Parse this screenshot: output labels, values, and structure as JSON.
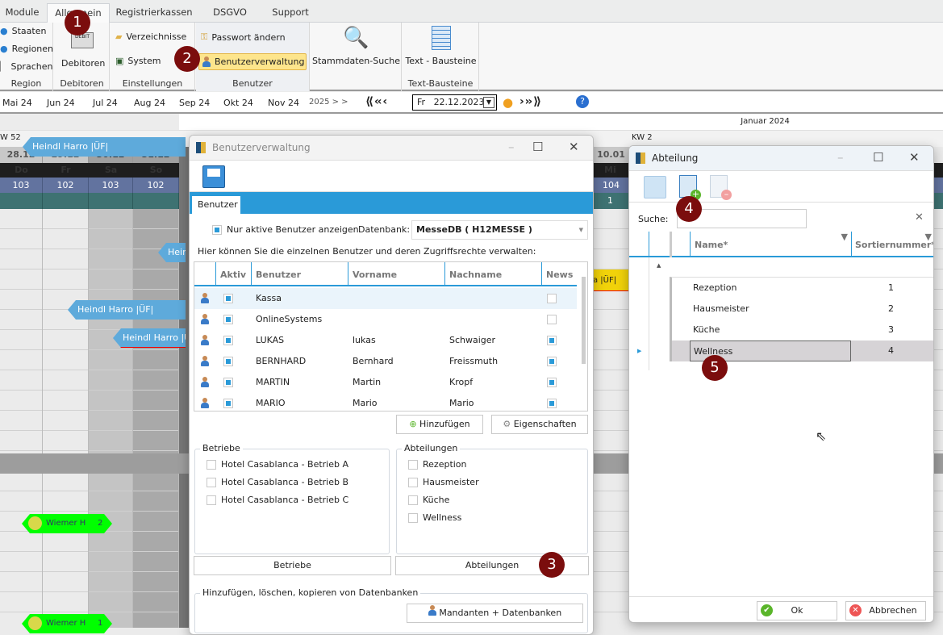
{
  "ribbon": {
    "tabs": [
      "Module",
      "Allgemein",
      "Registrierkassen",
      "DSGVO",
      "Support"
    ],
    "active_tab": "Allgemein",
    "region": {
      "items": [
        "Staaten",
        "Regionen",
        "Sprachen"
      ],
      "label": "Region"
    },
    "debitoren": {
      "button": "Debitoren",
      "label": "Debitoren",
      "icon_text": "DEBIT"
    },
    "einstellungen": {
      "items": [
        "Verzeichnisse",
        "System"
      ],
      "label": "Einstellungen"
    },
    "benutzer": {
      "items": [
        "Passwort ändern",
        "Benutzerverwaltung"
      ],
      "label": "Benutzer"
    },
    "stammdaten": {
      "button": "Stammdaten-Suche"
    },
    "textbausteine": {
      "button": "Text - Bausteine",
      "label": "Text-Bausteine"
    }
  },
  "nav": {
    "months": [
      "Mai 24",
      "Jun 24",
      "Jul 24",
      "Aug 24",
      "Sep 24",
      "Okt 24",
      "Nov 24"
    ],
    "next_year": "2025 > >",
    "date_day": "Fr",
    "date_value": "22.12.2023"
  },
  "calendar": {
    "month": "Januar 2024",
    "weeks": [
      "W 52",
      "KW 2"
    ],
    "dates": [
      {
        "d": "28.12",
        "w": "Do",
        "n": "103"
      },
      {
        "d": "29.12",
        "w": "Fr",
        "n": "102"
      },
      {
        "d": "30.12",
        "w": "Sa",
        "n": "103"
      },
      {
        "d": "31.12",
        "w": "So",
        "n": "102"
      }
    ],
    "right_col": {
      "d": "10.01",
      "w": "Mi",
      "n": "104",
      "c": "1"
    },
    "bookings": [
      "Heindl Harro |ÜF|",
      "Heindl Harro |ÜF|",
      "Heind",
      "Heindl Harro |ÜF|"
    ],
    "yellow_booking": "a |ÜF|",
    "green": [
      {
        "name": "Wiemer H",
        "n": "2"
      },
      {
        "name": "Wiemer H",
        "n": "1"
      }
    ]
  },
  "benutzerverwaltung": {
    "title": "Benutzerverwaltung",
    "tab": "Benutzer",
    "only_active": "Nur aktive Benutzer anzeigen",
    "db_label": "Datenbank:",
    "db_value": "MesseDB  ( H12MESSE )",
    "hint": "Hier können Sie die einzelnen Benutzer und deren Zugriffsrechte verwalten:",
    "columns": [
      "Aktiv",
      "Benutzer",
      "Vorname",
      "Nachname",
      "News"
    ],
    "rows": [
      {
        "aktiv": true,
        "user": "Kassa",
        "first": "",
        "last": "",
        "news": false
      },
      {
        "aktiv": true,
        "user": "OnlineSystems",
        "first": "",
        "last": "",
        "news": false
      },
      {
        "aktiv": true,
        "user": "LUKAS",
        "first": "lukas",
        "last": "Schwaiger",
        "news": true
      },
      {
        "aktiv": true,
        "user": "BERNHARD",
        "first": "Bernhard",
        "last": "Freissmuth",
        "news": true
      },
      {
        "aktiv": true,
        "user": "MARTIN",
        "first": "Martin",
        "last": "Kropf",
        "news": true
      },
      {
        "aktiv": true,
        "user": "MARIO",
        "first": "Mario",
        "last": "Mario",
        "news": true
      }
    ],
    "add": "Hinzufügen",
    "props": "Eigenschaften",
    "betriebe_label": "Betriebe",
    "betriebe": [
      "Hotel Casablanca - Betrieb A",
      "Hotel Casablanca - Betrieb B",
      "Hotel Casablanca - Betrieb C"
    ],
    "abteilungen_label": "Abteilungen",
    "abteilungen": [
      "Rezeption",
      "Hausmeister",
      "Küche",
      "Wellness"
    ],
    "betriebe_btn": "Betriebe",
    "abteilungen_btn": "Abteilungen",
    "db_group": "Hinzufügen, löschen, kopieren von Datenbanken",
    "mandanten_btn": "Mandanten + Datenbanken"
  },
  "abteilung": {
    "title": "Abteilung",
    "search_label": "Suche:",
    "search_value": "",
    "columns": [
      "Name*",
      "Sortiernummer*"
    ],
    "rows": [
      {
        "name": "Rezeption",
        "nr": "1"
      },
      {
        "name": "Hausmeister",
        "nr": "2"
      },
      {
        "name": "Küche",
        "nr": "3"
      },
      {
        "name": "Wellness",
        "nr": "4"
      }
    ],
    "selected": "Wellness",
    "ok": "Ok",
    "cancel": "Abbrechen"
  },
  "badges": [
    "1",
    "2",
    "3",
    "4",
    "5"
  ],
  "colors": {
    "accent": "#2a9ad8",
    "badge": "#7b0d0d",
    "booking": "#5eaadb",
    "green": "#00ff00",
    "highlight": "#fde58c"
  }
}
